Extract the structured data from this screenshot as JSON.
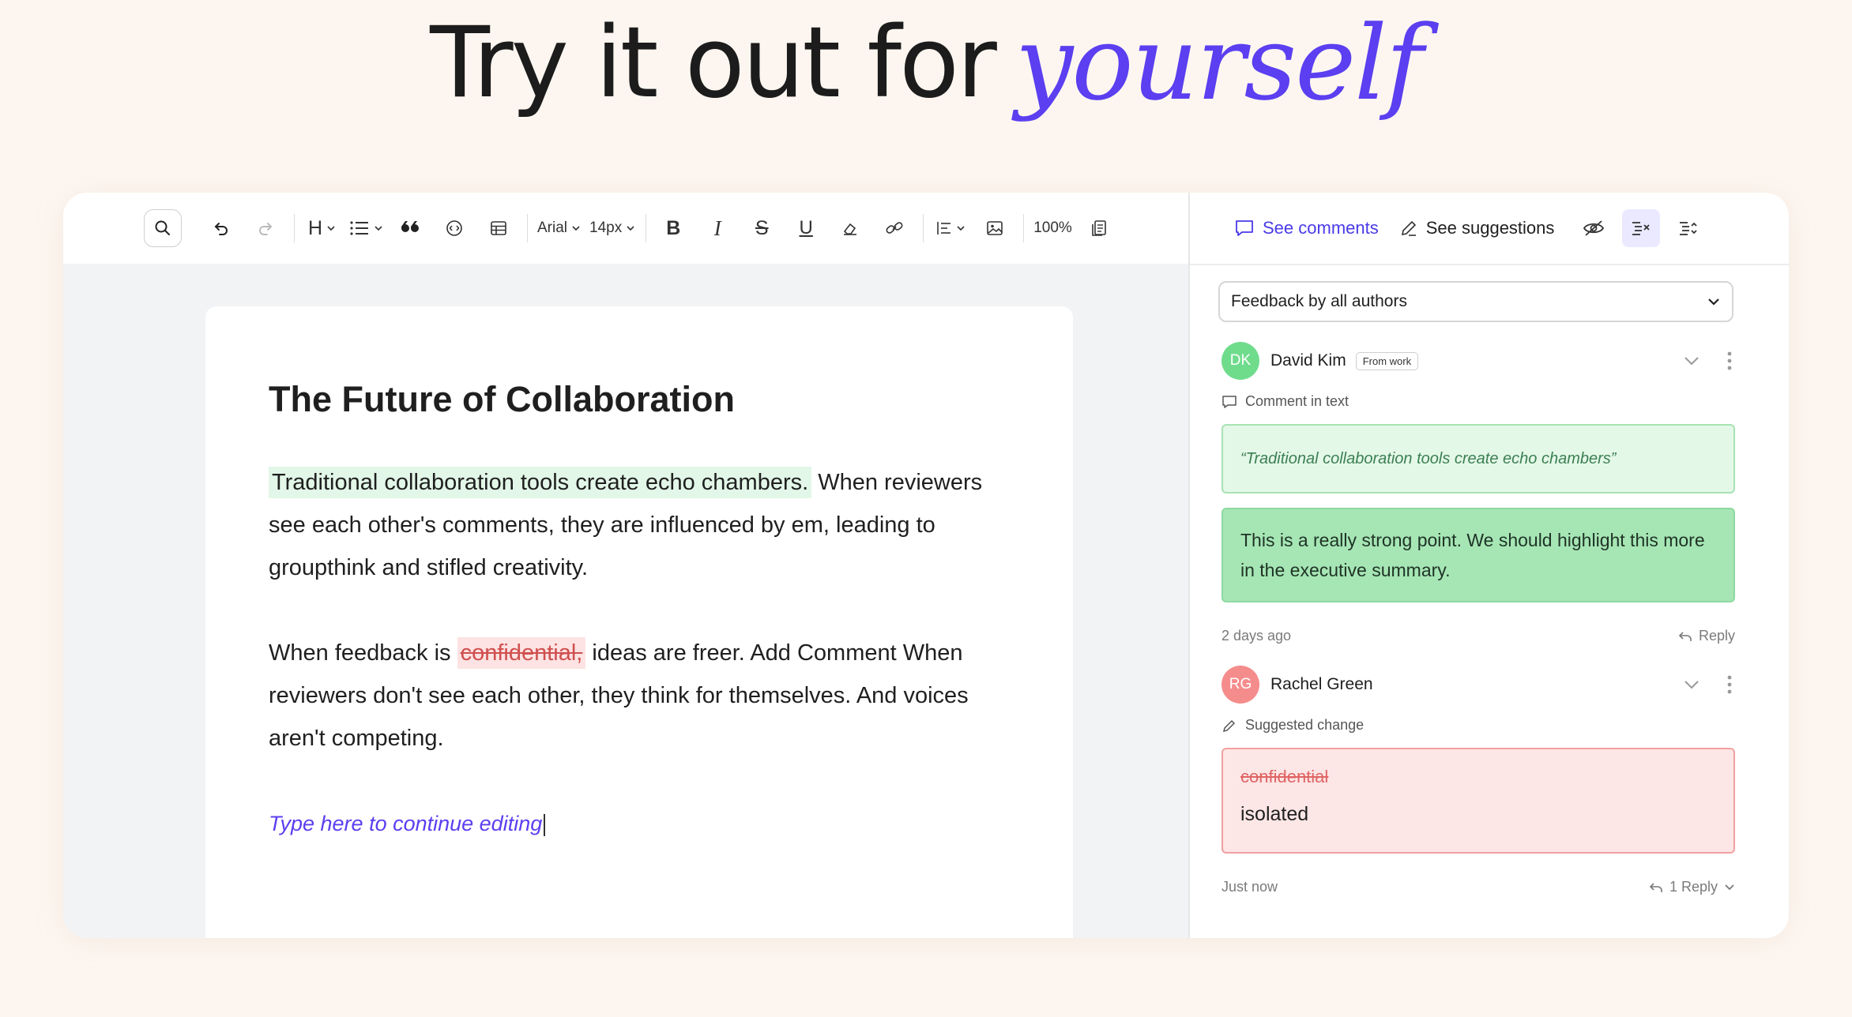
{
  "hero": {
    "plain": "Try it out for",
    "script": "yourself"
  },
  "toolbar": {
    "font_family": "Arial",
    "font_size": "14px",
    "zoom": "100%",
    "icons": [
      "search-icon",
      "undo-icon",
      "redo-icon",
      "heading-icon",
      "list-icon",
      "quote-icon",
      "code-icon",
      "table-icon",
      "bold-icon",
      "italic-icon",
      "strikethrough-icon",
      "underline-icon",
      "clear-format-icon",
      "link-icon",
      "align-icon",
      "image-icon",
      "pages-icon"
    ],
    "bold": "B",
    "italic": "I",
    "strike": "S",
    "underline": "U",
    "heading": "H"
  },
  "document": {
    "title": "The Future of Collaboration",
    "p1_highlight": "Traditional collaboration tools create echo chambers.",
    "p1_rest": " When reviewers see each other's comments, they are influenced by em, leading to groupthink and stifled creativity.",
    "p2_before": "When feedback is ",
    "p2_deleted": "confidential,",
    "p2_after": " ideas are freer. Add Comment When reviewers don't see each other, they think for themselves. And voices aren't competing.",
    "continue_text": "Type here to continue editing"
  },
  "sidebar": {
    "tab_comments": "See comments",
    "tab_suggestions": "See suggestions",
    "filter_label": "Feedback by all authors",
    "comments": [
      {
        "initials": "DK",
        "author": "David Kim",
        "tag": "From work",
        "avatar_color": "#6fdc8c",
        "kind": "Comment in text",
        "quote": "“Traditional collaboration tools create echo chambers”",
        "body": "This is a really strong point. We should highlight this more in the executive summary.",
        "time": "2 days ago",
        "reply_label": "Reply"
      },
      {
        "initials": "RG",
        "author": "Rachel Green",
        "avatar_color": "#f58c8c",
        "kind": "Suggested change",
        "old_text": "confidential",
        "new_text": "isolated",
        "time": "Just now",
        "reply_label": "1 Reply"
      }
    ]
  },
  "colors": {
    "accent": "#5b3ff0",
    "background": "#fdf6f0",
    "comment_green": "#a6e6b5",
    "suggest_red": "#fde6e6"
  }
}
